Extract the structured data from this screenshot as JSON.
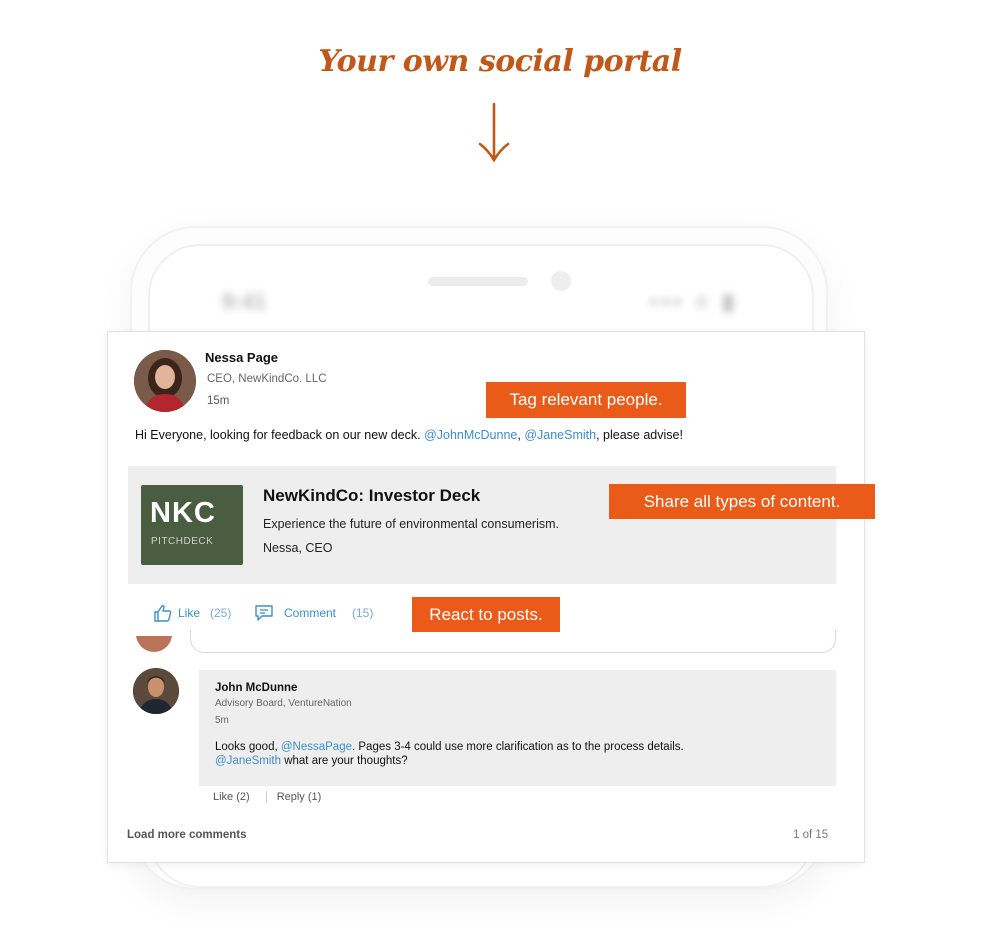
{
  "hero": {
    "title": "Your own social portal"
  },
  "status_bar": {
    "time": "9:41",
    "icons": "••• ≡ ▮"
  },
  "post": {
    "author_name": "Nessa Page",
    "author_role": "CEO,  NewKindCo. LLC",
    "time": "15m",
    "text_before": "Hi Everyone, looking for feedback on our new deck. ",
    "mention_1": "@JohnMcDunne",
    "sep": ", ",
    "mention_2": "@JaneSmith",
    "text_after": ", please advise!",
    "attachment": {
      "thumb_logo": "NKC",
      "thumb_sub": "PITCHDECK",
      "title": "NewKindCo: Investor Deck",
      "description": "Experience the future of environmental consumerism.",
      "author": "Nessa, CEO"
    },
    "actions": {
      "like_label": "Like",
      "like_count": "(25)",
      "comment_label": "Comment",
      "comment_count": "(15)"
    }
  },
  "callouts": {
    "tag": "Tag relevant people.",
    "share": "Share all types of content.",
    "react": "React to posts."
  },
  "comment": {
    "author_name": "John McDunne",
    "author_role": "Advisory Board, VentureNation",
    "time": "5m",
    "text_1": "Looks good, ",
    "mention_1": "@NessaPage",
    "text_2": ". Pages 3-4 could use more clarification as to the process details. ",
    "mention_2": "@JaneSmith",
    "text_3": " what are your thoughts?",
    "like": "Like (2)",
    "reply": "Reply (1)"
  },
  "footer": {
    "load_more": "Load more comments",
    "pager": "1 of 15"
  },
  "colors": {
    "accent_orange": "#ea5b1a",
    "title_orange": "#c0581a",
    "link_blue": "#3d8ec9",
    "thumb_green": "#4a5d40"
  }
}
